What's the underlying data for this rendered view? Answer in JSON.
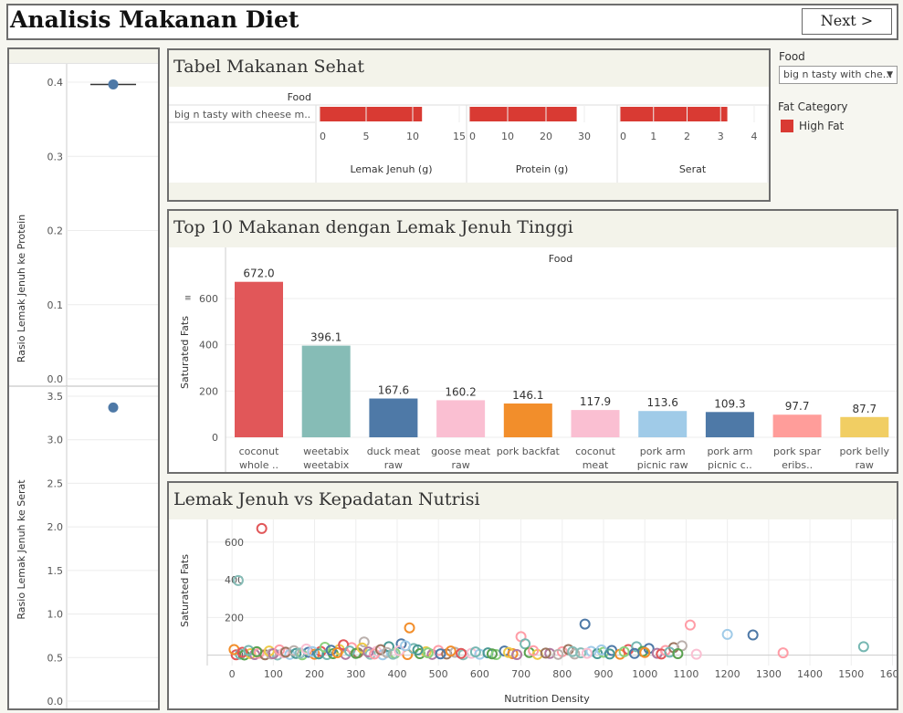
{
  "header": {
    "title": "Analisis Makanan Diet",
    "next_label": "Next >"
  },
  "filters": {
    "food_label": "Food",
    "food_value": "big n tasty with che...",
    "fat_category_label": "Fat Category",
    "legend": [
      {
        "label": "High Fat",
        "color": "#d93a33"
      }
    ]
  },
  "left_panel": {
    "top_axis_label": "Rasio Lemak Jenuh ke Protein",
    "top_ticks": [
      "0.4",
      "0.3",
      "0.2",
      "0.1",
      "0.0"
    ],
    "bottom_axis_label": "Rasio Lemak Jenuh ke Serat",
    "bottom_ticks": [
      "3.5",
      "3.0",
      "2.5",
      "2.0",
      "1.5",
      "1.0",
      "0.5",
      "0.0"
    ]
  },
  "table_panel": {
    "title": "Tabel Makanan Sehat",
    "row_header": "Food",
    "row_label": "big n tasty with cheese m..",
    "columns": [
      {
        "label": "Lemak Jenuh (g)",
        "ticks": [
          "0",
          "5",
          "10",
          "15"
        ]
      },
      {
        "label": "Protein (g)",
        "ticks": [
          "0",
          "10",
          "20",
          "30"
        ]
      },
      {
        "label": "Serat",
        "ticks": [
          "0",
          "1",
          "2",
          "3",
          "4"
        ]
      }
    ]
  },
  "bar_panel": {
    "title": "Top 10 Makanan dengan Lemak Jenuh Tinggi"
  },
  "scatter_panel": {
    "title": "Lemak Jenuh vs Kepadatan Nutrisi"
  },
  "chart_data": [
    {
      "type": "scatter",
      "name": "Rasio Lemak Jenuh ke Protein",
      "ylabel": "Rasio Lemak Jenuh ke Protein",
      "ylim": [
        0,
        0.42
      ],
      "points": [
        {
          "y": 0.397
        }
      ]
    },
    {
      "type": "scatter",
      "name": "Rasio Lemak Jenuh ke Serat",
      "ylabel": "Rasio Lemak Jenuh ke Serat",
      "ylim": [
        0,
        3.6
      ],
      "points": [
        {
          "y": 3.37
        }
      ]
    },
    {
      "type": "bar",
      "orientation": "horizontal",
      "categories": [
        "big n tasty with cheese m.."
      ],
      "series": [
        {
          "name": "Lemak Jenuh (g)",
          "values": [
            11
          ],
          "xlim": [
            0,
            15
          ]
        },
        {
          "name": "Protein (g)",
          "values": [
            28
          ],
          "xlim": [
            0,
            30
          ]
        },
        {
          "name": "Serat",
          "values": [
            3.2
          ],
          "xlim": [
            0,
            4
          ]
        }
      ]
    },
    {
      "type": "bar",
      "title": "Top 10 Makanan dengan Lemak Jenuh Tinggi",
      "xlabel": "Food",
      "ylabel": "Saturated Fats",
      "ylim": [
        0,
        730
      ],
      "yticks": [
        0,
        200,
        400,
        600
      ],
      "categories": [
        [
          "coconut",
          "whole .."
        ],
        [
          "weetabix",
          "weetabix"
        ],
        [
          "duck meat",
          "raw"
        ],
        [
          "goose meat",
          "raw"
        ],
        [
          "pork backfat",
          ""
        ],
        [
          "coconut",
          "meat"
        ],
        [
          "pork arm",
          "picnic raw"
        ],
        [
          "pork arm",
          "picnic c.."
        ],
        [
          "pork spar",
          "eribs.."
        ],
        [
          "pork belly",
          "raw"
        ]
      ],
      "values": [
        672.0,
        396.1,
        167.6,
        160.2,
        146.1,
        117.9,
        113.6,
        109.3,
        97.7,
        87.7
      ],
      "labels": [
        "672.0",
        "396.1",
        "167.6",
        "160.2",
        "146.1",
        "117.9",
        "113.6",
        "109.3",
        "97.7",
        "87.7"
      ],
      "colors": [
        "#e15759",
        "#86bcb6",
        "#4e79a7",
        "#fabfd2",
        "#f28e2b",
        "#fabfd2",
        "#a0cbe8",
        "#4e79a7",
        "#ff9d9a",
        "#f1ce63"
      ]
    },
    {
      "type": "scatter",
      "title": "Lemak Jenuh vs Kepadatan Nutrisi",
      "xlabel": "Nutrition Density",
      "ylabel": "Saturated Fats",
      "xlim": [
        -60,
        1610
      ],
      "ylim": [
        -55,
        720
      ],
      "xticks": [
        0,
        100,
        200,
        300,
        400,
        500,
        600,
        700,
        800,
        900,
        1000,
        1100,
        1200,
        1300,
        1400,
        1500,
        1600
      ],
      "yticks": [
        0,
        200,
        400,
        600
      ],
      "palette": [
        "#4e79a7",
        "#f28e2b",
        "#e15759",
        "#76b7b2",
        "#59a14f",
        "#edc948",
        "#b07aa1",
        "#ff9da7",
        "#9c755f",
        "#bab0ac",
        "#86bcb6",
        "#fabfd2",
        "#a0cbe8",
        "#499894",
        "#8cd17d"
      ],
      "points": [
        {
          "x": 72,
          "y": 672,
          "c": "#e15759"
        },
        {
          "x": 15,
          "y": 396,
          "c": "#86bcb6"
        },
        {
          "x": 10,
          "y": 2
        },
        {
          "x": 20,
          "y": 5
        },
        {
          "x": 30,
          "y": 1
        },
        {
          "x": 45,
          "y": 8
        },
        {
          "x": 55,
          "y": 3
        },
        {
          "x": 65,
          "y": 10
        },
        {
          "x": 80,
          "y": 2
        },
        {
          "x": 95,
          "y": 6
        },
        {
          "x": 110,
          "y": 1
        },
        {
          "x": 125,
          "y": 12
        },
        {
          "x": 140,
          "y": 4
        },
        {
          "x": 155,
          "y": 9
        },
        {
          "x": 170,
          "y": 2
        },
        {
          "x": 185,
          "y": 15
        },
        {
          "x": 200,
          "y": 5
        },
        {
          "x": 215,
          "y": 20
        },
        {
          "x": 230,
          "y": 3
        },
        {
          "x": 245,
          "y": 8
        },
        {
          "x": 260,
          "y": 30
        },
        {
          "x": 275,
          "y": 4
        },
        {
          "x": 290,
          "y": 40
        },
        {
          "x": 305,
          "y": 12
        },
        {
          "x": 320,
          "y": 70
        },
        {
          "x": 335,
          "y": 5
        },
        {
          "x": 350,
          "y": 20
        },
        {
          "x": 365,
          "y": 2
        },
        {
          "x": 380,
          "y": 45
        },
        {
          "x": 395,
          "y": 10
        },
        {
          "x": 410,
          "y": 60
        },
        {
          "x": 425,
          "y": 3
        },
        {
          "x": 430,
          "y": 145,
          "c": "#f28e2b"
        },
        {
          "x": 440,
          "y": 35
        },
        {
          "x": 455,
          "y": 8
        },
        {
          "x": 470,
          "y": 18
        },
        {
          "x": 485,
          "y": 4
        },
        {
          "x": 500,
          "y": 25
        },
        {
          "x": 520,
          "y": 6
        },
        {
          "x": 540,
          "y": 15
        },
        {
          "x": 560,
          "y": 2
        },
        {
          "x": 580,
          "y": 10
        },
        {
          "x": 600,
          "y": 5
        },
        {
          "x": 620,
          "y": 12
        },
        {
          "x": 640,
          "y": 3
        },
        {
          "x": 660,
          "y": 22
        },
        {
          "x": 680,
          "y": 8
        },
        {
          "x": 700,
          "y": 98,
          "c": "#ff9da7"
        },
        {
          "x": 710,
          "y": 60
        },
        {
          "x": 720,
          "y": 14
        },
        {
          "x": 740,
          "y": 4
        },
        {
          "x": 770,
          "y": 9
        },
        {
          "x": 800,
          "y": 18
        },
        {
          "x": 815,
          "y": 30
        },
        {
          "x": 830,
          "y": 6
        },
        {
          "x": 845,
          "y": 12
        },
        {
          "x": 855,
          "y": 165,
          "c": "#4e79a7"
        },
        {
          "x": 870,
          "y": 20
        },
        {
          "x": 885,
          "y": 8
        },
        {
          "x": 900,
          "y": 15
        },
        {
          "x": 920,
          "y": 25
        },
        {
          "x": 940,
          "y": 5
        },
        {
          "x": 960,
          "y": 30
        },
        {
          "x": 980,
          "y": 45
        },
        {
          "x": 995,
          "y": 20
        },
        {
          "x": 1010,
          "y": 35,
          "c": "#4e79a7"
        },
        {
          "x": 1030,
          "y": 10
        },
        {
          "x": 1050,
          "y": 25
        },
        {
          "x": 1070,
          "y": 40
        },
        {
          "x": 1090,
          "y": 50
        },
        {
          "x": 1110,
          "y": 160,
          "c": "#ff9da7"
        },
        {
          "x": 1125,
          "y": 5
        },
        {
          "x": 1200,
          "y": 110,
          "c": "#a0cbe8"
        },
        {
          "x": 1262,
          "y": 107,
          "c": "#4e79a7"
        },
        {
          "x": 1335,
          "y": 12,
          "c": "#ff9da7"
        },
        {
          "x": 1530,
          "y": 45,
          "c": "#76b7b2"
        },
        {
          "x": 5,
          "y": 30
        },
        {
          "x": 25,
          "y": 15
        },
        {
          "x": 40,
          "y": 25
        },
        {
          "x": 60,
          "y": 18
        },
        {
          "x": 90,
          "y": 22
        },
        {
          "x": 100,
          "y": 8
        },
        {
          "x": 115,
          "y": 28
        },
        {
          "x": 130,
          "y": 16
        },
        {
          "x": 150,
          "y": 24
        },
        {
          "x": 165,
          "y": 11
        },
        {
          "x": 180,
          "y": 33
        },
        {
          "x": 195,
          "y": 19
        },
        {
          "x": 210,
          "y": 7
        },
        {
          "x": 225,
          "y": 42
        },
        {
          "x": 240,
          "y": 26
        },
        {
          "x": 255,
          "y": 13
        },
        {
          "x": 270,
          "y": 55
        },
        {
          "x": 285,
          "y": 22
        },
        {
          "x": 300,
          "y": 9
        },
        {
          "x": 315,
          "y": 38
        },
        {
          "x": 330,
          "y": 17
        },
        {
          "x": 345,
          "y": 6
        },
        {
          "x": 360,
          "y": 29
        },
        {
          "x": 375,
          "y": 14
        },
        {
          "x": 390,
          "y": 5
        },
        {
          "x": 405,
          "y": 24
        },
        {
          "x": 420,
          "y": 50
        },
        {
          "x": 450,
          "y": 28
        },
        {
          "x": 475,
          "y": 12
        },
        {
          "x": 505,
          "y": 7
        },
        {
          "x": 530,
          "y": 22
        },
        {
          "x": 555,
          "y": 9
        },
        {
          "x": 590,
          "y": 17
        },
        {
          "x": 630,
          "y": 7
        },
        {
          "x": 670,
          "y": 14
        },
        {
          "x": 690,
          "y": 3
        },
        {
          "x": 730,
          "y": 24
        },
        {
          "x": 760,
          "y": 11
        },
        {
          "x": 790,
          "y": 4
        },
        {
          "x": 825,
          "y": 19
        },
        {
          "x": 860,
          "y": 10
        },
        {
          "x": 895,
          "y": 28
        },
        {
          "x": 915,
          "y": 6
        },
        {
          "x": 950,
          "y": 18
        },
        {
          "x": 975,
          "y": 9
        },
        {
          "x": 1000,
          "y": 14
        },
        {
          "x": 1040,
          "y": 6
        },
        {
          "x": 1060,
          "y": 16
        },
        {
          "x": 1080,
          "y": 8
        }
      ]
    }
  ]
}
